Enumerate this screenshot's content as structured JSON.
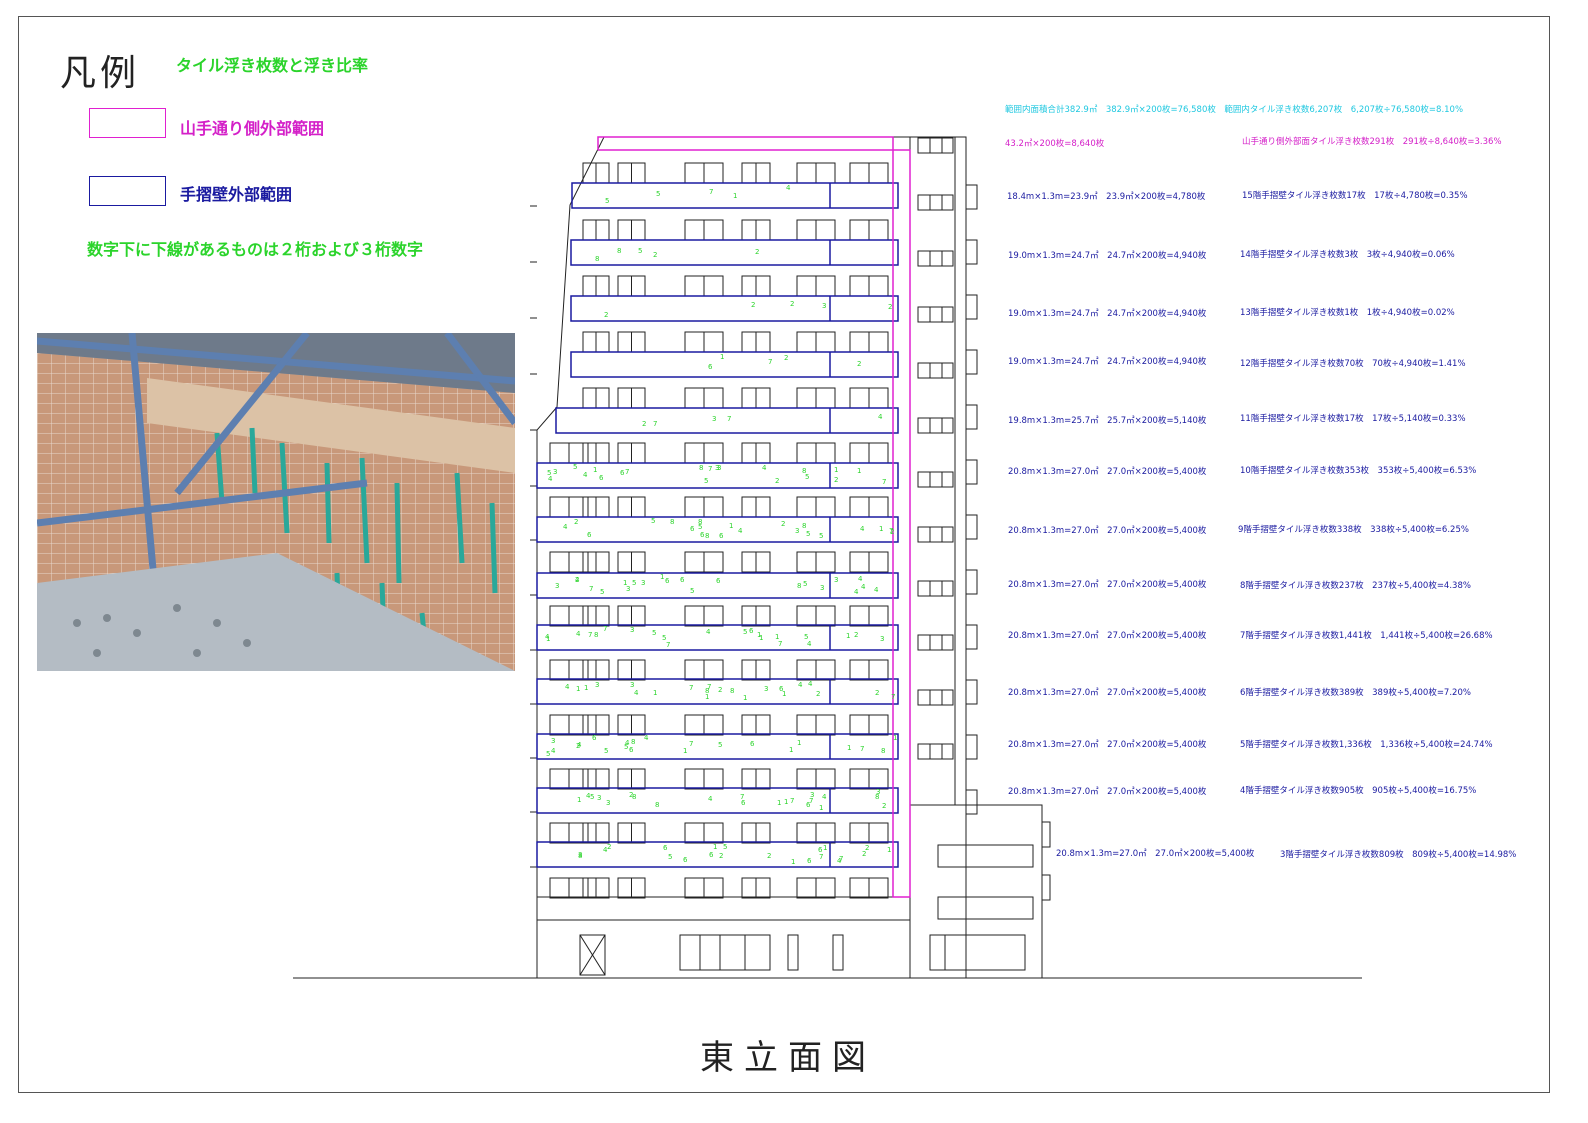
{
  "legend": {
    "title": "凡例",
    "subtitle": "タイル浮き枚数と浮き比率",
    "magenta_label": "山手通り側外部範囲",
    "blue_label": "手摺壁外部範囲",
    "note": "数字下に下線があるものは２桁および３桁数字"
  },
  "colors": {
    "magenta": "#d420c8",
    "blue": "#1a1aa0",
    "green": "#2bd42b",
    "cyan": "#20c8e0",
    "tile": "#c8987a",
    "scaffold": "#6f8fb8"
  },
  "summary": {
    "total": "範囲内面積合計382.9㎡　382.9㎡×200枚=76,580枚　範囲内タイル浮き枚数6,207枚　6,207枚÷76,580枚=8.10%",
    "yamate_area": "43.2㎡×200枚=8,640枚",
    "yamate_ratio": "山手通り側外部面タイル浮き枚数291枚　291枚÷8,640枚=3.36%"
  },
  "floors": [
    {
      "area": "18.4m×1.3m=23.9㎡　23.9㎡×200枚=4,780枚",
      "ratio": "15階手摺壁タイル浮き枚数17枚　17枚÷4,780枚=0.35%"
    },
    {
      "area": "19.0m×1.3m=24.7㎡　24.7㎡×200枚=4,940枚",
      "ratio": "14階手摺壁タイル浮き枚数3枚　3枚÷4,940枚=0.06%"
    },
    {
      "area": "19.0m×1.3m=24.7㎡　24.7㎡×200枚=4,940枚",
      "ratio": "13階手摺壁タイル浮き枚数1枚　1枚÷4,940枚=0.02%"
    },
    {
      "area": "19.0m×1.3m=24.7㎡　24.7㎡×200枚=4,940枚",
      "ratio": "12階手摺壁タイル浮き枚数70枚　70枚÷4,940枚=1.41%"
    },
    {
      "area": "19.8m×1.3m=25.7㎡　25.7㎡×200枚=5,140枚",
      "ratio": "11階手摺壁タイル浮き枚数17枚　17枚÷5,140枚=0.33%"
    },
    {
      "area": "20.8m×1.3m=27.0㎡　27.0㎡×200枚=5,400枚",
      "ratio": "10階手摺壁タイル浮き枚数353枚　353枚÷5,400枚=6.53%"
    },
    {
      "area": "20.8m×1.3m=27.0㎡　27.0㎡×200枚=5,400枚",
      "ratio": "9階手摺壁タイル浮き枚数338枚　338枚÷5,400枚=6.25%"
    },
    {
      "area": "20.8m×1.3m=27.0㎡　27.0㎡×200枚=5,400枚",
      "ratio": "8階手摺壁タイル浮き枚数237枚　237枚÷5,400枚=4.38%"
    },
    {
      "area": "20.8m×1.3m=27.0㎡　27.0㎡×200枚=5,400枚",
      "ratio": "7階手摺壁タイル浮き枚数1,441枚　1,441枚÷5,400枚=26.68%"
    },
    {
      "area": "20.8m×1.3m=27.0㎡　27.0㎡×200枚=5,400枚",
      "ratio": "6階手摺壁タイル浮き枚数389枚　389枚÷5,400枚=7.20%"
    },
    {
      "area": "20.8m×1.3m=27.0㎡　27.0㎡×200枚=5,400枚",
      "ratio": "5階手摺壁タイル浮き枚数1,336枚　1,336枚÷5,400枚=24.74%"
    },
    {
      "area": "20.8m×1.3m=27.0㎡　27.0㎡×200枚=5,400枚",
      "ratio": "4階手摺壁タイル浮き枚数905枚　905枚÷5,400枚=16.75%"
    },
    {
      "area": "20.8m×1.3m=27.0㎡　27.0㎡×200枚=5,400枚",
      "ratio": "3階手摺壁タイル浮き枚数809枚　809枚÷5,400枚=14.98%"
    }
  ],
  "drawing_title": "東立面図"
}
